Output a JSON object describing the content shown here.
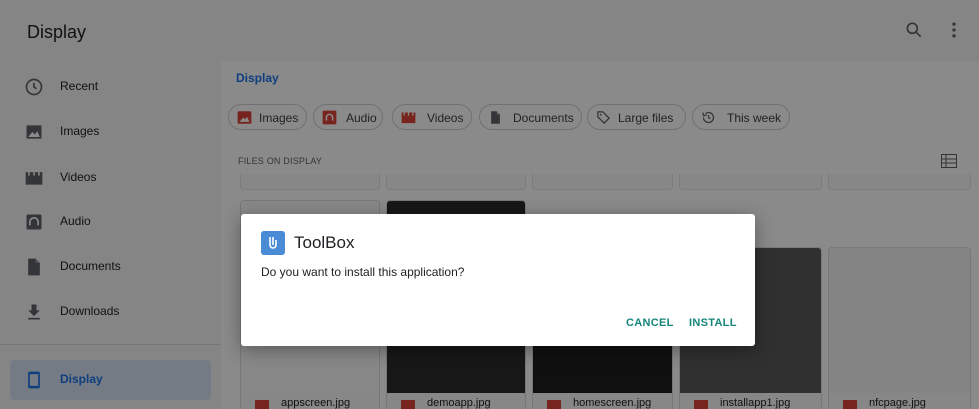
{
  "app": {
    "title": "Display",
    "toolbar_icons": [
      "search-icon",
      "more-vert-icon"
    ]
  },
  "sidebar": {
    "items": [
      {
        "label": "Recent",
        "icon": "clock-icon"
      },
      {
        "label": "Images",
        "icon": "image-icon"
      },
      {
        "label": "Videos",
        "icon": "video-icon"
      },
      {
        "label": "Audio",
        "icon": "audio-icon"
      },
      {
        "label": "Documents",
        "icon": "document-icon"
      },
      {
        "label": "Downloads",
        "icon": "download-icon"
      },
      {
        "label": "Display",
        "icon": "tablet-icon",
        "active": true
      }
    ]
  },
  "main": {
    "breadcrumb": "Display",
    "chips": [
      {
        "label": "Images",
        "icon": "image-icon"
      },
      {
        "label": "Audio",
        "icon": "audio-icon"
      },
      {
        "label": "Videos",
        "icon": "video-icon"
      },
      {
        "label": "Documents",
        "icon": "document-icon"
      },
      {
        "label": "Large files",
        "icon": "tag-icon"
      },
      {
        "label": "This week",
        "icon": "history-icon"
      }
    ],
    "section_title": "FILES ON DISPLAY",
    "files": [
      {
        "name": "appscreen.jpg"
      },
      {
        "name": "demoapp.jpg"
      },
      {
        "name": "homescreen.jpg"
      },
      {
        "name": "installapp1.jpg"
      },
      {
        "name": "nfcpage.jpg"
      }
    ]
  },
  "dialog": {
    "app_name": "ToolBox",
    "message": "Do you want to install this application?",
    "cancel_label": "CANCEL",
    "install_label": "INSTALL"
  },
  "colors": {
    "accent": "#1a73e8",
    "dialog_button": "#15857a",
    "scrim": "#000000"
  }
}
